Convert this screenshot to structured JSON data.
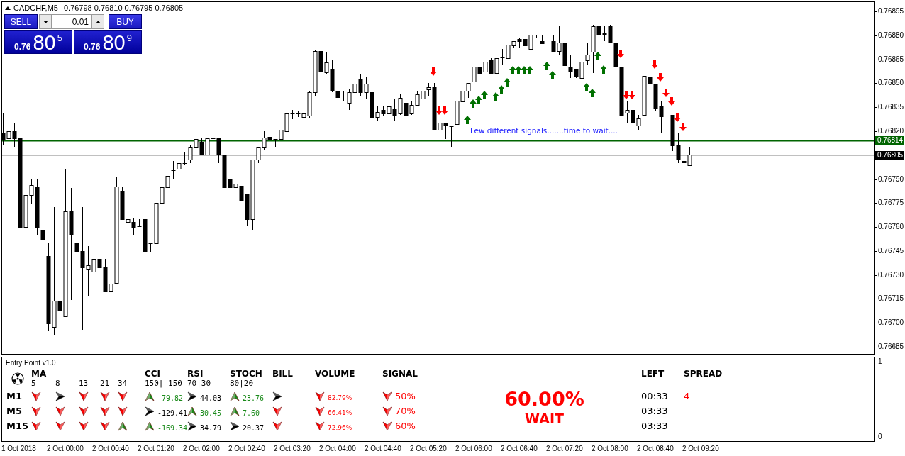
{
  "chart": {
    "symbol": "CADCHF,M5",
    "quote": "0.76798 0.76810 0.76795 0.76805",
    "note": "Few different signals.......time to wait...."
  },
  "trade_panel": {
    "sell_label": "SELL",
    "buy_label": "BUY",
    "lot": "0.01",
    "sell_price": {
      "prefix": "0.76",
      "big": "80",
      "small": "5"
    },
    "buy_price": {
      "prefix": "0.76",
      "big": "80",
      "small": "9"
    }
  },
  "price_axis": [
    "0.76895",
    "0.76880",
    "0.76865",
    "0.76850",
    "0.76835",
    "0.76820",
    "0.76790",
    "0.76775",
    "0.76760",
    "0.76745",
    "0.76730",
    "0.76715",
    "0.76700",
    "0.76685"
  ],
  "price_lines": [
    {
      "label": "0.76814",
      "kind": "level"
    },
    {
      "label": "0.76805",
      "kind": "bid"
    }
  ],
  "indicator": {
    "title": "Entry Point v1.0",
    "scale": [
      "1",
      "0"
    ],
    "headers": [
      {
        "title": "MA",
        "params": [
          "5",
          "8",
          "13",
          "21",
          "34"
        ]
      },
      {
        "title": "CCI",
        "params": [
          "150|-150"
        ]
      },
      {
        "title": "RSI",
        "params": [
          "70|30"
        ]
      },
      {
        "title": "STOCH",
        "params": [
          "80|20"
        ]
      },
      {
        "title": "BILL"
      },
      {
        "title": "VOLUME"
      },
      {
        "title": "SIGNAL"
      },
      {
        "title": "LEFT"
      },
      {
        "title": "SPREAD"
      }
    ],
    "rows": [
      {
        "timeframe": "M1",
        "ma": [
          {
            "kind": "down"
          },
          {
            "kind": "right"
          },
          {
            "kind": "down"
          },
          {
            "kind": "down"
          },
          {
            "kind": "down"
          }
        ],
        "cci": {
          "kind": "up",
          "value": "-79.82"
        },
        "rsi": {
          "kind": "right",
          "value": "44.03"
        },
        "stoch": {
          "kind": "up",
          "value": "23.76"
        },
        "bill": {
          "kind": "right"
        },
        "volume": {
          "kind": "down",
          "value": "82.79%"
        },
        "signal": {
          "kind": "down",
          "value": "50%"
        },
        "left": "00:33",
        "spread": "4"
      },
      {
        "timeframe": "M5",
        "ma": [
          {
            "kind": "down"
          },
          {
            "kind": "down"
          },
          {
            "kind": "down"
          },
          {
            "kind": "down"
          },
          {
            "kind": "down"
          }
        ],
        "cci": {
          "kind": "right",
          "value": "-129.41"
        },
        "rsi": {
          "kind": "up",
          "value": "30.45"
        },
        "stoch": {
          "kind": "up",
          "value": "7.60"
        },
        "bill": {
          "kind": "down"
        },
        "volume": {
          "kind": "down",
          "value": "66.41%"
        },
        "signal": {
          "kind": "down",
          "value": "70%"
        },
        "left": "03:33"
      },
      {
        "timeframe": "M15",
        "ma": [
          {
            "kind": "down"
          },
          {
            "kind": "down"
          },
          {
            "kind": "down"
          },
          {
            "kind": "down"
          },
          {
            "kind": "up"
          }
        ],
        "cci": {
          "kind": "up",
          "value": "-169.34"
        },
        "rsi": {
          "kind": "right",
          "value": "34.79"
        },
        "stoch": {
          "kind": "right",
          "value": "20.37"
        },
        "bill": {
          "kind": "down"
        },
        "volume": {
          "kind": "down",
          "value": "72.96%"
        },
        "signal": {
          "kind": "down",
          "value": "60%"
        },
        "left": "03:33"
      }
    ],
    "result": {
      "value": "60.00%",
      "action": "WAIT"
    }
  },
  "time_axis": [
    "1 Oct 2018",
    "2 Oct 00:00",
    "2 Oct 00:40",
    "2 Oct 01:20",
    "2 Oct 02:00",
    "2 Oct 02:40",
    "2 Oct 03:20",
    "2 Oct 04:00",
    "2 Oct 04:40",
    "2 Oct 05:20",
    "2 Oct 06:00",
    "2 Oct 06:40",
    "2 Oct 07:20",
    "2 Oct 08:00",
    "2 Oct 08:40",
    "2 Oct 09:20"
  ]
}
